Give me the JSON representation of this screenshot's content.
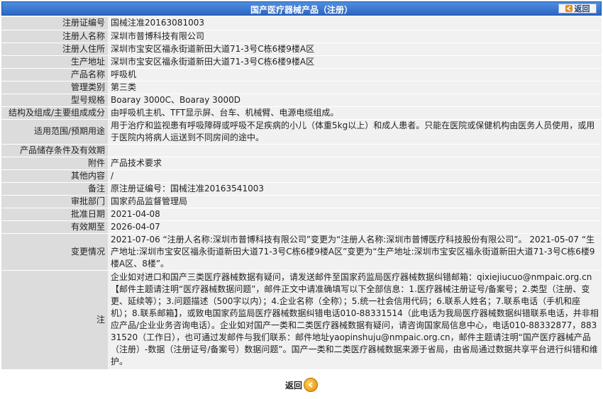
{
  "header": {
    "title": "国产医疗器械产品（注册）",
    "back_label": "返回"
  },
  "rows": [
    {
      "label": "注册证编号",
      "value": "国械注准20163081003"
    },
    {
      "label": "注册人名称",
      "value": "深圳市普博科技有限公司"
    },
    {
      "label": "注册人住所",
      "value": "深圳市宝安区福永街道新田大道71-3号C栋6楼9楼A区"
    },
    {
      "label": "生产地址",
      "value": "深圳市宝安区福永街道新田大道71-3号C栋6楼9楼A区"
    },
    {
      "label": "产品名称",
      "value": "呼吸机"
    },
    {
      "label": "管理类别",
      "value": "第三类"
    },
    {
      "label": "型号规格",
      "value": "Boaray 3000C、Boaray 3000D"
    },
    {
      "label": "结构及组成/主要组成成分",
      "value": "由呼吸机主机、TFT显示屏、台车、机械臂、电源电缆组成。"
    },
    {
      "label": "适用范围/预期用途",
      "value": "用于治疗和监视患有呼吸障碍或呼吸不足疾病的小儿（体重5kg以上）和成人患者。只能在医院或保健机构由医务人员使用，或用于医院内将病人运送到不同房间的途中。"
    },
    {
      "label": "产品储存条件及有效期",
      "value": ""
    },
    {
      "label": "附件",
      "value": "产品技术要求"
    },
    {
      "label": "其他内容",
      "value": "/"
    },
    {
      "label": "备注",
      "value": "原注册证编号：国械注准20163541003"
    },
    {
      "label": "审批部门",
      "value": "国家药品监督管理局"
    },
    {
      "label": "批准日期",
      "value": "2021-04-08"
    },
    {
      "label": "有效期至",
      "value": "2026-04-07"
    },
    {
      "label": "变更情况",
      "value": "2021-07-06 “注册人名称:深圳市普博科技有限公司”变更为“注册人名称:深圳市普博医疗科技股份有限公司”。 2021-05-07 “生产地址:深圳市宝安区福永街道新田大道71-3号C栋6楼9楼A区”变更为“生产地址:深圳市宝安区福永街道新田大道71-3号C栋6楼9楼A区、8楼”。"
    },
    {
      "label": "注",
      "value": "企业如对进口和国产三类医疗器械数据有疑问，请发送邮件至国家药监局医疗器械数据纠错邮箱：qixiejiucuo@nmpaic.org.cn【邮件主题请注明“医疗器械数据问题”，邮件正文中请准确填写以下全部信息：1.医疗器械注册证号/备案号；2.类型（注册、变更、延续等）；3.问题描述（500字以内）；4.企业名称（全称）；5.统一社会信用代码；6.联系人姓名；7.联系电话（手机和座机）；8.联系邮箱】，或致电国家药监局医疗器械数据纠错电话010-88331514（此电话为我局医疗器械数据纠错联系电话，并非相应产品/企业业务咨询电话）。企业如对国产一类和二类医疗器械数据有疑问，请咨询国家局信息中心，电话010-88332877，88331520（工作日），也可通过发邮件与我们联系：邮件地址yaopinshuju@nmpaic.org.cn，邮件主题请注明“国产医疗器械产品（注册）-数据（注册证号/备案号）数据问题”。国产一类和二类医疗器械数据来源于省局，由省局通过数据共享平台进行纠错和维护。"
    }
  ],
  "footer": {
    "back_label": "返回"
  },
  "colors": {
    "title_bar": "#2c66c2",
    "label_bg": "#dcdcdc",
    "value_bg": "#f1f1f1",
    "back_icon": "#e78a1a"
  },
  "icons": {
    "back_top": "left-arrow-icon",
    "back_bottom": "orange-circle-back-icon"
  }
}
